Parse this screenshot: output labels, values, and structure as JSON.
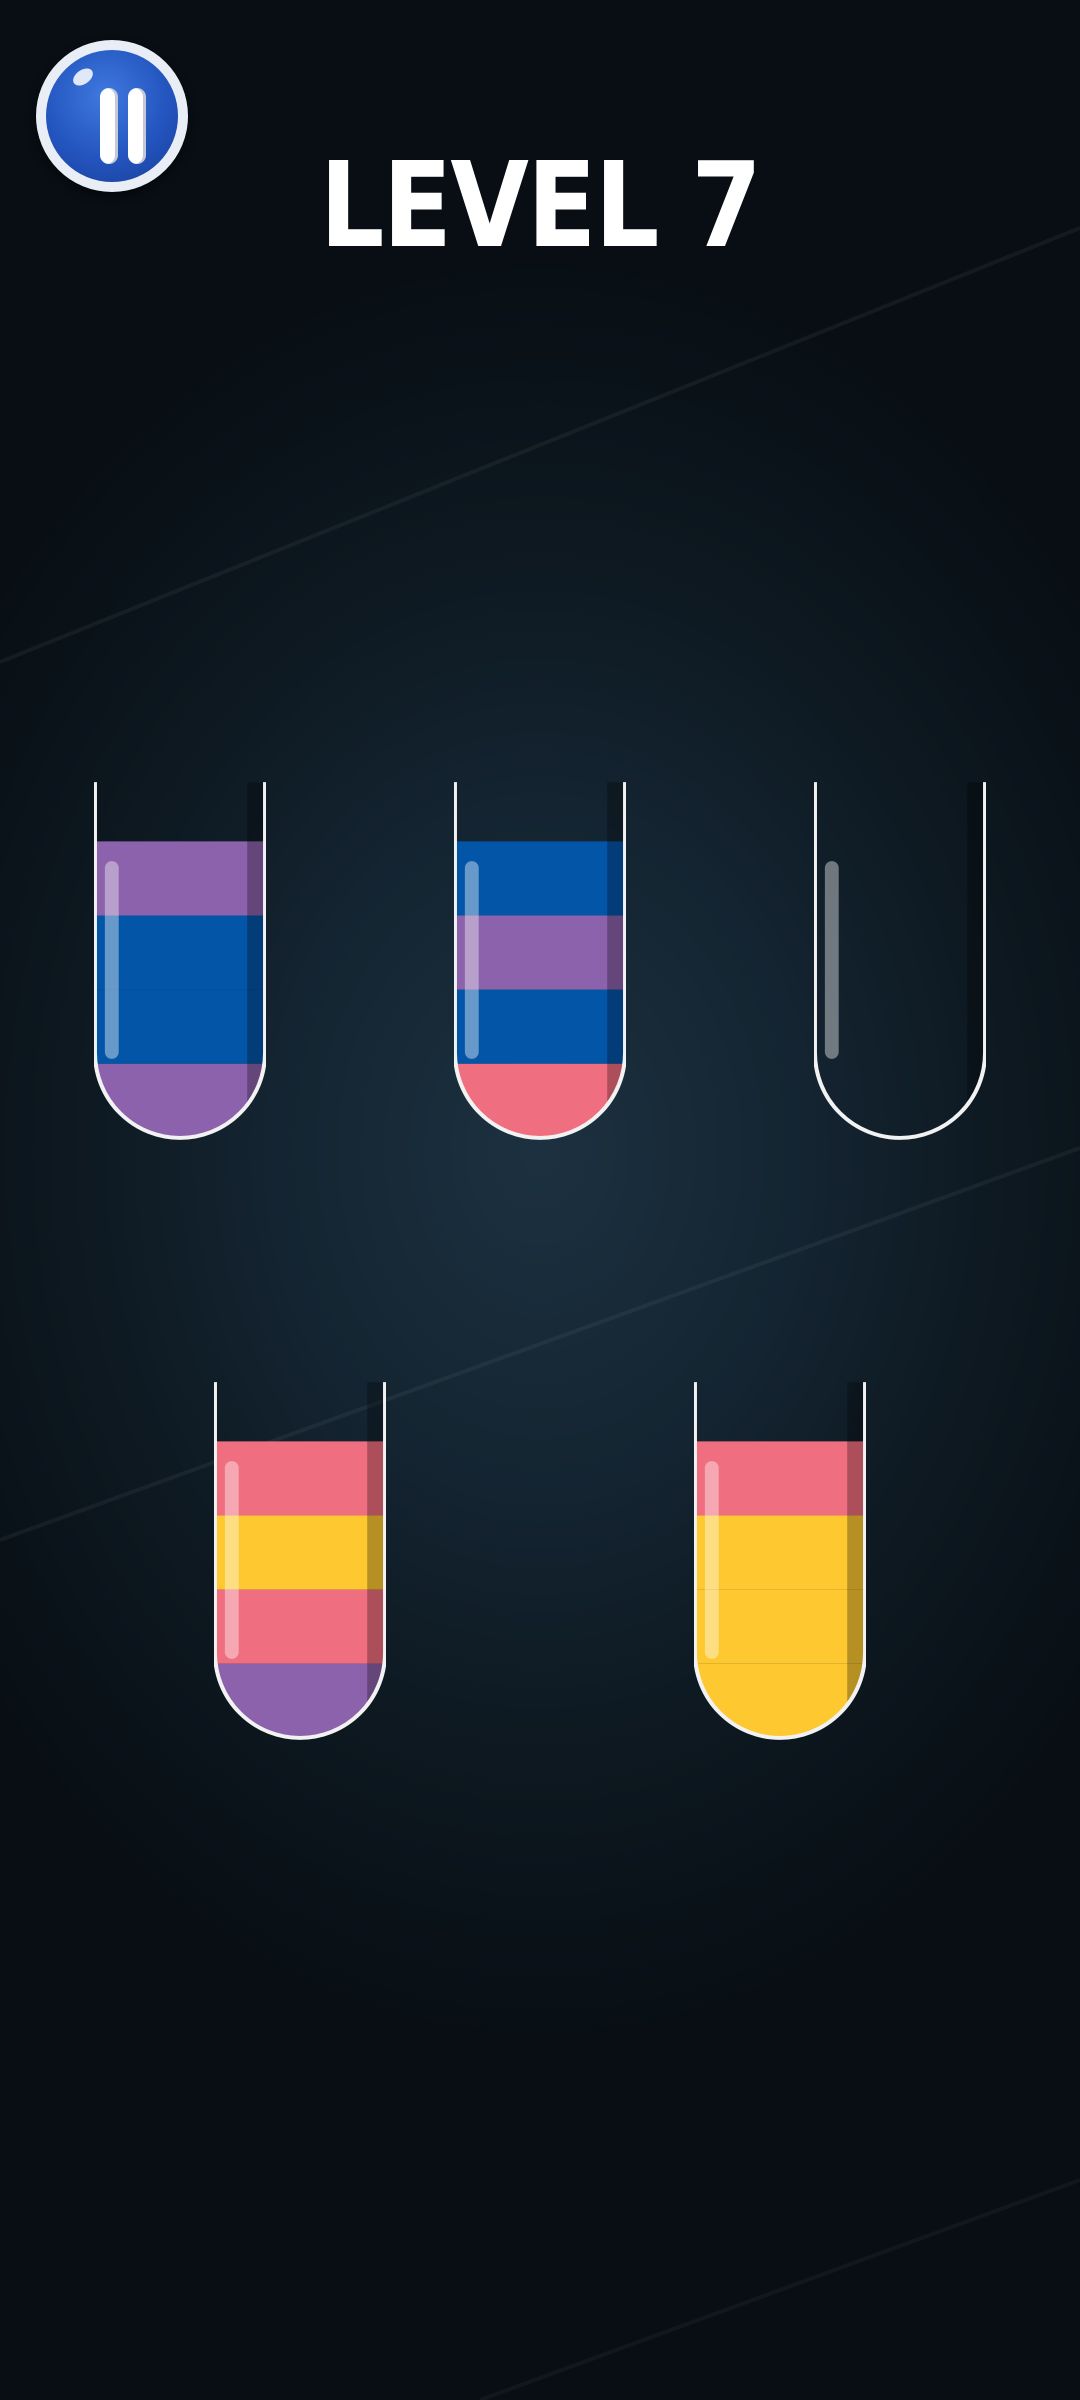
{
  "level_title": "LEVEL 7",
  "colors": {
    "purple": "#8b62ab",
    "blue": "#0355a8",
    "pink": "#ef6e7f",
    "yellow": "#fdc830",
    "tube_outline": "#f2f2f2"
  },
  "icons": {
    "pause": "pause-icon"
  },
  "tubes_top_to_bottom_layers": [
    [
      "purple",
      "blue",
      "blue",
      "purple"
    ],
    [
      "blue",
      "purple",
      "blue",
      "pink"
    ],
    [],
    [
      "pink",
      "yellow",
      "pink",
      "purple"
    ],
    [
      "pink",
      "yellow",
      "yellow",
      "yellow"
    ]
  ]
}
